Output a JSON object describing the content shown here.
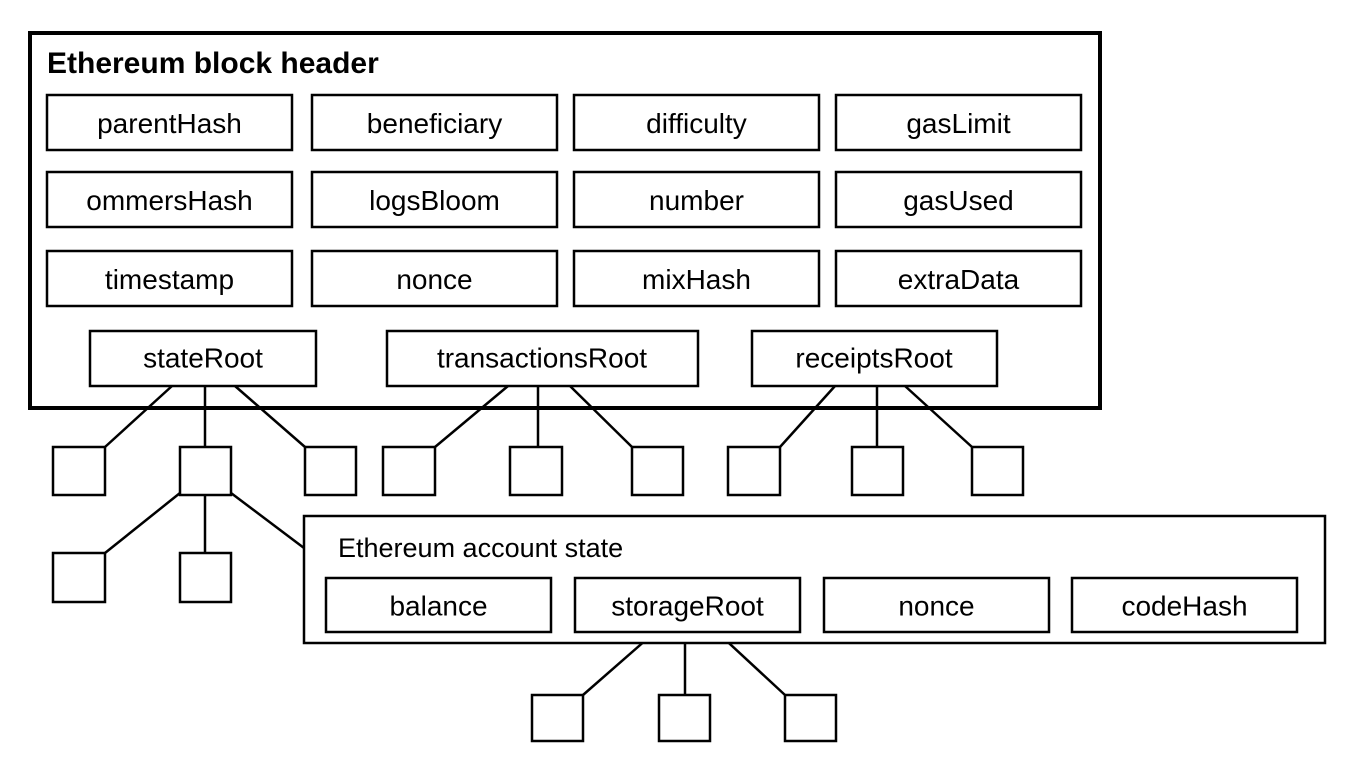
{
  "block_header": {
    "title": "Ethereum block header",
    "fields": [
      [
        "parentHash",
        "beneficiary",
        "difficulty",
        "gasLimit"
      ],
      [
        "ommersHash",
        "logsBloom",
        "number",
        "gasUsed"
      ],
      [
        "timestamp",
        "nonce",
        "mixHash",
        "extraData"
      ]
    ],
    "roots": [
      "stateRoot",
      "transactionsRoot",
      "receiptsRoot"
    ]
  },
  "account_state": {
    "title": "Ethereum account state",
    "fields": [
      "balance",
      "storageRoot",
      "nonce",
      "codeHash"
    ]
  }
}
